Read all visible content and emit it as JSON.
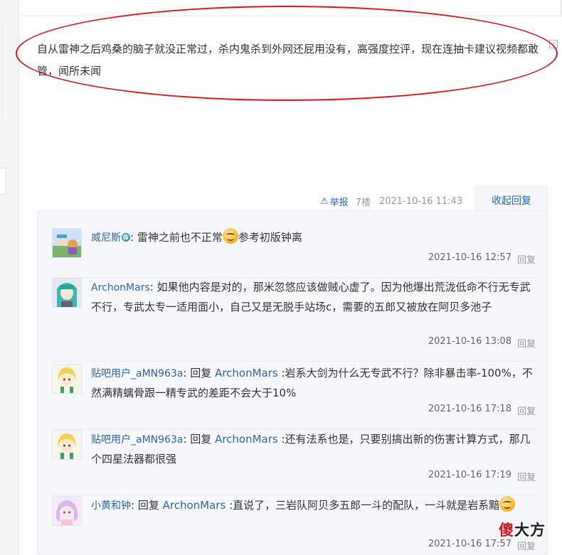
{
  "post": {
    "text": "自从雷神之后鸡桑的脑子就没正常过，杀内鬼杀到外网还屁用没有，高强度控评，现在连抽卡建议视频都敢管，闻所未闻"
  },
  "meta": {
    "report_label": "举报",
    "floor": "7楼",
    "timestamp": "2021-10-16 11:43",
    "collapse_label": "收起回复"
  },
  "replies": [
    {
      "user": "威尼斯",
      "prefix": "",
      "target": "",
      "text_before": "雷神之前也不正常",
      "text_after": "参考初版钟离",
      "time": "2021-10-16 12:57",
      "reply_label": "回复"
    },
    {
      "user": "ArchonMars",
      "prefix": "",
      "target": "",
      "text": "如果他内容是对的，那米忽悠应该做贼心虚了。因为他爆出荒泷低命不行无专武不行，专武太专一适用面小，自己又是无脱手站场c，需要的五郎又被放在阿贝多池子",
      "time": "2021-10-16 13:08",
      "reply_label": "回复"
    },
    {
      "user": "贴吧用户_aMN963a",
      "prefix": "回复",
      "target": "ArchonMars",
      "text": ":岩系大剑为什么无专武不行？除非暴击率-100%，不然满精螭骨跟一精专武的差距不会大于10%",
      "time": "2021-10-16 17:18",
      "reply_label": "回复"
    },
    {
      "user": "贴吧用户_aMN963a",
      "prefix": "回复",
      "target": "ArchonMars",
      "text": ":还有法系也是，只要别搞出新的伤害计算方式，那几个四星法器都很强",
      "time": "2021-10-16 17:19",
      "reply_label": "回复"
    },
    {
      "user": "小黄和钟",
      "prefix": "回复",
      "target": "ArchonMars",
      "text": ":直说了，三岩队阿贝多五郎一斗的配队，一斗就是岩系黯",
      "time": "2021-10-16 17:57",
      "reply_label": "回复"
    }
  ],
  "watermark": {
    "red": "傻",
    "black": "大方"
  },
  "colors": {
    "link": "#2d64b3",
    "annotation": "#e0121e",
    "panel_bg": "#f5f7fa"
  }
}
